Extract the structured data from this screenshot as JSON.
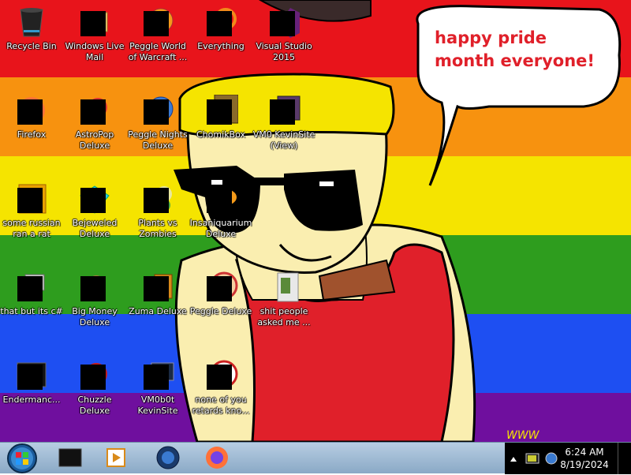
{
  "wallpaper": {
    "speech_bubble_text": "happy pride month everyone!",
    "stripe_colors": [
      "#e8141b",
      "#f7920f",
      "#f5e400",
      "#2e9d1e",
      "#1e4ff2",
      "#6f0f9e"
    ]
  },
  "desktop_icons": [
    {
      "label": "Recycle Bin",
      "icon": "recycle-bin-icon"
    },
    {
      "label": "Windows Live Mail",
      "icon": "mail-icon"
    },
    {
      "label": "Peggle World of Warcraft ...",
      "icon": "game-icon"
    },
    {
      "label": "Everything",
      "icon": "search-icon"
    },
    {
      "label": "Visual Studio 2015",
      "icon": "visual-studio-icon"
    },
    {
      "label": "Firefox",
      "icon": "firefox-icon"
    },
    {
      "label": "AstroPop Deluxe",
      "icon": "game-icon"
    },
    {
      "label": "Peggle Nights Deluxe",
      "icon": "game-icon"
    },
    {
      "label": "ChomikBox",
      "icon": "chomikbox-icon"
    },
    {
      "label": "VM0 KevinSite (View)",
      "icon": "shortcut-icon"
    },
    {
      "label": "some russian ran a rat",
      "icon": "document-icon"
    },
    {
      "label": "Bejeweled Deluxe",
      "icon": "gem-icon"
    },
    {
      "label": "Plants vs Zombies",
      "icon": "game-icon"
    },
    {
      "label": "Insaniquarium Deluxe",
      "icon": "fish-icon"
    },
    {
      "label": "that but its c#",
      "icon": "copy-icon"
    },
    {
      "label": "Big Money Deluxe",
      "icon": "money-bag-icon"
    },
    {
      "label": "Zuma Deluxe",
      "icon": "zuma-icon"
    },
    {
      "label": "Peggle Deluxe",
      "icon": "game-icon"
    },
    {
      "label": "shit people asked me ...",
      "icon": "folder-icon"
    },
    {
      "label": "Endermanc...",
      "icon": "terminal-icon"
    },
    {
      "label": "Chuzzle Deluxe",
      "icon": "game-icon"
    },
    {
      "label": "VM0b0t KevinSite",
      "icon": "monitor-icon"
    },
    {
      "label": "none of you retards kno...",
      "icon": "app-icon"
    }
  ],
  "taskbar": {
    "pinned": [
      {
        "name": "terminal-app",
        "icon": "terminal-icon"
      },
      {
        "name": "media-player",
        "icon": "media-player-icon"
      },
      {
        "name": "browser-app",
        "icon": "globe-icon"
      },
      {
        "name": "firefox",
        "icon": "firefox-icon"
      }
    ],
    "clock": {
      "time": "6:24 AM",
      "date": "8/19/2024"
    }
  }
}
